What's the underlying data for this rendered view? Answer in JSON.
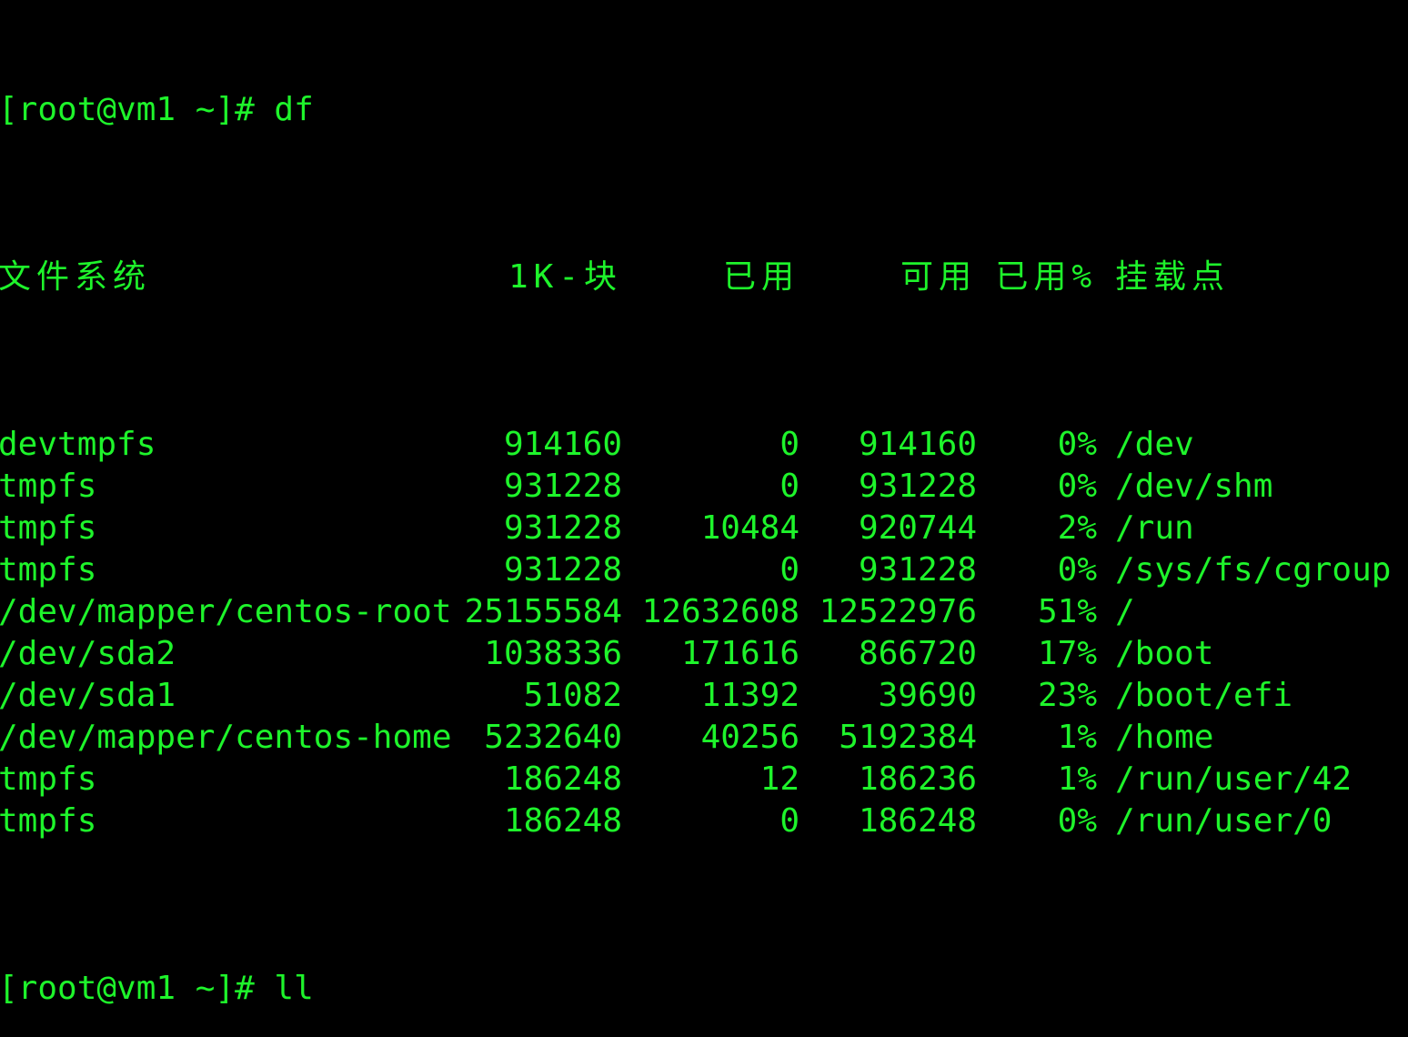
{
  "terminal": {
    "prompt_command": "[root@vm1 ~]# df",
    "header": {
      "filesystem": "文件系统",
      "blocks": "1K-块",
      "used": "已用",
      "available": "可用",
      "use_percent": "已用%",
      "mounted_on": "挂载点"
    },
    "rows": [
      {
        "filesystem": "devtmpfs",
        "blocks": "914160",
        "used": "0",
        "available": "914160",
        "use_percent": "0%",
        "mounted_on": "/dev"
      },
      {
        "filesystem": "tmpfs",
        "blocks": "931228",
        "used": "0",
        "available": "931228",
        "use_percent": "0%",
        "mounted_on": "/dev/shm"
      },
      {
        "filesystem": "tmpfs",
        "blocks": "931228",
        "used": "10484",
        "available": "920744",
        "use_percent": "2%",
        "mounted_on": "/run"
      },
      {
        "filesystem": "tmpfs",
        "blocks": "931228",
        "used": "0",
        "available": "931228",
        "use_percent": "0%",
        "mounted_on": "/sys/fs/cgroup"
      },
      {
        "filesystem": "/dev/mapper/centos-root",
        "blocks": "25155584",
        "used": "12632608",
        "available": "12522976",
        "use_percent": "51%",
        "mounted_on": "/"
      },
      {
        "filesystem": "/dev/sda2",
        "blocks": "1038336",
        "used": "171616",
        "available": "866720",
        "use_percent": "17%",
        "mounted_on": "/boot"
      },
      {
        "filesystem": "/dev/sda1",
        "blocks": "51082",
        "used": "11392",
        "available": "39690",
        "use_percent": "23%",
        "mounted_on": "/boot/efi"
      },
      {
        "filesystem": "/dev/mapper/centos-home",
        "blocks": "5232640",
        "used": "40256",
        "available": "5192384",
        "use_percent": "1%",
        "mounted_on": "/home"
      },
      {
        "filesystem": "tmpfs",
        "blocks": "186248",
        "used": "12",
        "available": "186236",
        "use_percent": "1%",
        "mounted_on": "/run/user/42"
      },
      {
        "filesystem": "tmpfs",
        "blocks": "186248",
        "used": "0",
        "available": "186248",
        "use_percent": "0%",
        "mounted_on": "/run/user/0"
      }
    ],
    "next_prompt": "[root@vm1 ~]# ll",
    "colors": {
      "background": "#000000",
      "text": "#1ef42b"
    }
  }
}
